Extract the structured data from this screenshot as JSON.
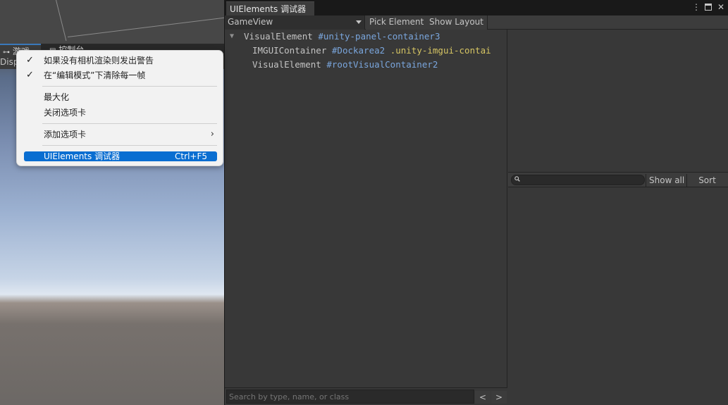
{
  "game_view": {
    "tabs": [
      {
        "icon": "gamepad-icon",
        "label": "游戏"
      },
      {
        "icon": "console-icon",
        "label": "控制台"
      }
    ],
    "toolbar_text": "Disp"
  },
  "context_menu": {
    "items": [
      {
        "label": "如果没有相机渲染则发出警告",
        "checked": true
      },
      {
        "label": "在“编辑模式”下清除每一帧",
        "checked": true
      },
      {
        "label": "最大化",
        "checked": false
      },
      {
        "label": "关闭选项卡",
        "checked": false
      },
      {
        "label": "添加选项卡",
        "submenu": true
      },
      {
        "label": "UIElements 调试器",
        "shortcut": "Ctrl+F5",
        "selected": true
      }
    ],
    "check_glyph": "✓",
    "submenu_glyph": "›"
  },
  "debugger": {
    "tab_title": "UIElements 调试器",
    "window_icons": [
      "more-icon",
      "maximize-icon",
      "close-icon"
    ],
    "panel_selector": "GameView",
    "pick_element": "Pick Element",
    "show_layout": "Show Layout",
    "tree": [
      {
        "type": "VisualElement",
        "name": "#unity-panel-container3",
        "class": "",
        "expanded": true
      },
      {
        "type": "IMGUIContainer",
        "name": "#Dockarea2",
        "class": ".unity-imgui-contai",
        "expanded": false
      },
      {
        "type": "VisualElement",
        "name": "#rootVisualContainer2",
        "class": "",
        "expanded": false
      }
    ],
    "search_placeholder": "Search by type, name, or class",
    "prev_label": "<",
    "next_label": ">",
    "styles_show_all": "Show all",
    "styles_sort": "Sort"
  },
  "colors": {
    "accent": "#0a6ed1",
    "element_name": "#7aa6dd",
    "class_name": "#d6c563",
    "panel_bg": "#383838"
  }
}
